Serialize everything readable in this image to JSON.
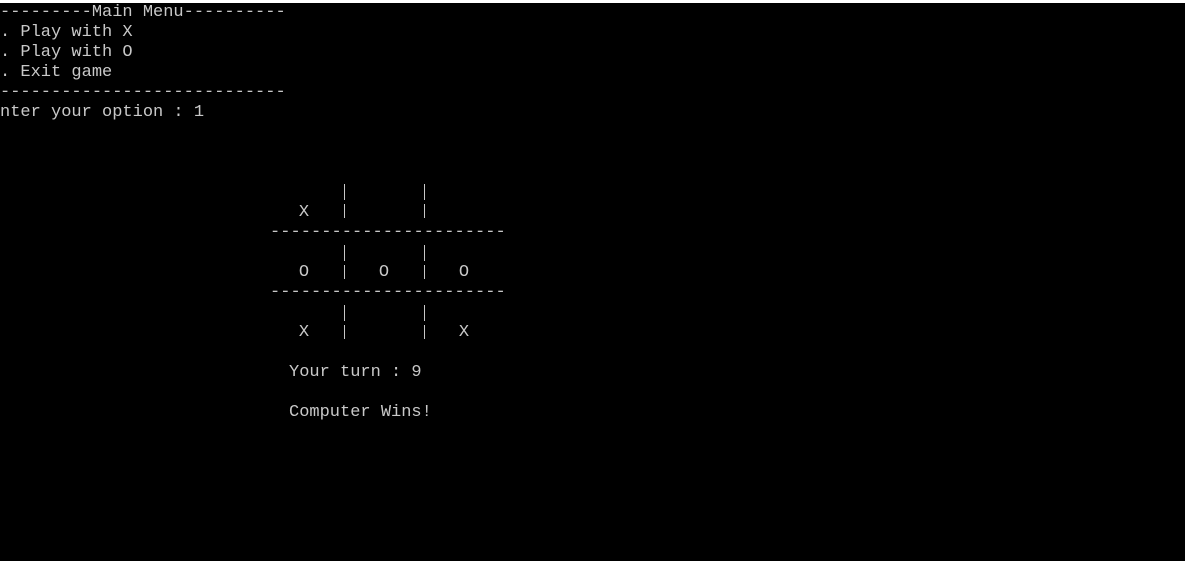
{
  "menu": {
    "header": "---------Main Menu----------",
    "options": [
      ". Play with X",
      ". Play with O",
      ". Exit game"
    ],
    "footer": "----------------------------",
    "prompt": "nter your option : 1"
  },
  "board": {
    "rows": [
      [
        "X",
        "",
        ""
      ],
      [
        "O",
        "O",
        "O"
      ],
      [
        "X",
        "",
        "X"
      ]
    ],
    "separator": "-----------------------"
  },
  "status": {
    "turn": "Your turn : 9",
    "result": "Computer Wins!"
  }
}
